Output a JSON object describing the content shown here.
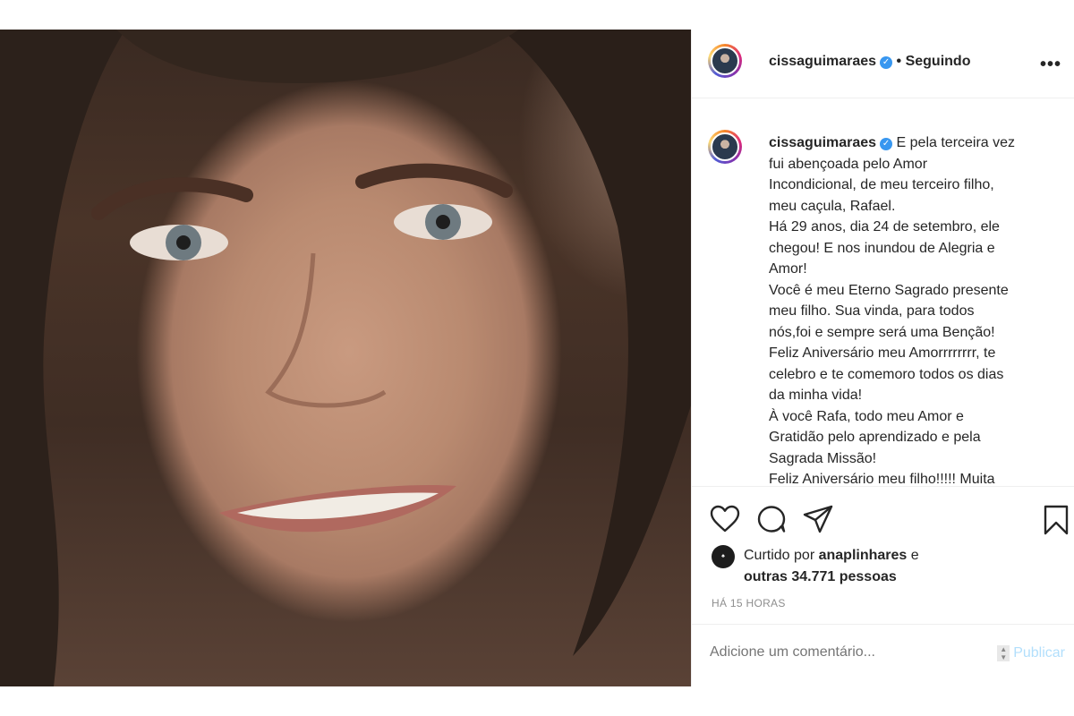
{
  "post": {
    "username": "cissaguimaraes",
    "follow_status": "• Seguindo",
    "more_icon": "more-options-icon",
    "caption_lines": [
      "E pela terceira vez",
      "fui abençoada pelo Amor",
      "Incondicional, de meu terceiro filho,",
      "meu caçula, Rafael.",
      "Há 29 anos, dia 24 de setembro, ele",
      "chegou! E nos inundou de Alegria e",
      "Amor!",
      "Você é meu Eterno Sagrado presente",
      "meu filho. Sua vinda, para todos",
      "nós,foi e sempre será uma Benção!",
      "Feliz Aniversário meu Amorrrrrrrr, te",
      "celebro e te comemoro todos os dias",
      "da minha vida!",
      "À você Rafa, todo meu Amor e",
      "Gratidão pelo aprendizado e pela",
      "Sagrada Missão!",
      "Feliz Aniversário meu filho!!!!! Muita"
    ],
    "likes_prefix": "Curtido por",
    "likes_user": "anaplinhares",
    "likes_suffix": "e",
    "likes_others": "outras 34.771 pessoas",
    "time_ago": "HÁ 15 HORAS",
    "comment_placeholder": "Adicione um comentário...",
    "publish_label": "Publicar"
  },
  "colors": {
    "accent": "#3897f0",
    "publish_disabled": "#b2dffc",
    "muted": "#8e8e8e",
    "text": "#262626"
  }
}
